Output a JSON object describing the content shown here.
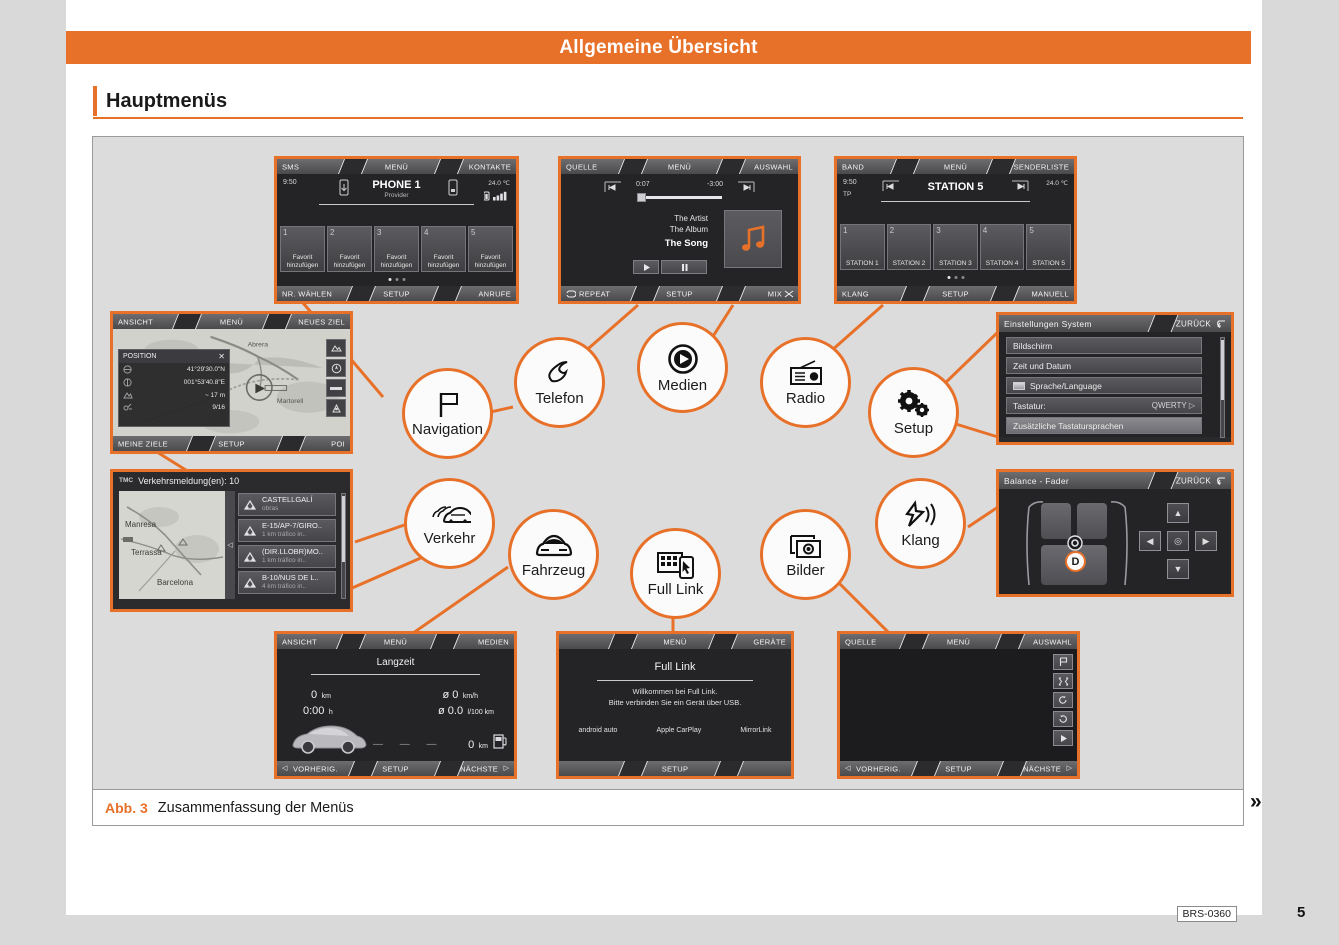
{
  "header": {
    "title": "Allgemeine Übersicht"
  },
  "section": {
    "title": "Hauptmenüs"
  },
  "figure": {
    "abb": "Abb. 3",
    "caption": "Zusammenfassung der Menüs",
    "code": "BRS-0360",
    "next_chevron": "»"
  },
  "page_number": "5",
  "nodes": [
    {
      "id": "navigation",
      "label": "Navigation",
      "icon": "flag-icon"
    },
    {
      "id": "telefon",
      "label": "Telefon",
      "icon": "phone-icon"
    },
    {
      "id": "medien",
      "label": "Medien",
      "icon": "play-circle-icon"
    },
    {
      "id": "radio",
      "label": "Radio",
      "icon": "radio-icon"
    },
    {
      "id": "setup",
      "label": "Setup",
      "icon": "gears-icon"
    },
    {
      "id": "verkehr",
      "label": "Verkehr",
      "icon": "traffic-cars-icon"
    },
    {
      "id": "fahrzeug",
      "label": "Fahrzeug",
      "icon": "car-icon"
    },
    {
      "id": "fulllink",
      "label": "Full Link",
      "icon": "fulllink-icon"
    },
    {
      "id": "bilder",
      "label": "Bilder",
      "icon": "photos-icon"
    },
    {
      "id": "klang",
      "label": "Klang",
      "icon": "speaker-icon"
    }
  ],
  "screens": {
    "phone": {
      "top": {
        "left": "SMS",
        "center": "MENÜ",
        "right": "KONTAKTE"
      },
      "bottom": {
        "left": "NR. WÄHLEN",
        "center": "SETUP",
        "right": "ANRUFE"
      },
      "clock": "9:50",
      "temp": "24.0 ℃",
      "title": "PHONE 1",
      "subtitle": "Provider",
      "presets": [
        {
          "num": "1",
          "label": "Favorit hinzufügen"
        },
        {
          "num": "2",
          "label": "Favorit hinzufügen"
        },
        {
          "num": "3",
          "label": "Favorit hinzufügen"
        },
        {
          "num": "4",
          "label": "Favorit hinzufügen"
        },
        {
          "num": "5",
          "label": "Favorit hinzufügen"
        }
      ]
    },
    "media": {
      "top": {
        "left": "QUELLE",
        "center": "MENÜ",
        "right": "AUSWAHL"
      },
      "bottom": {
        "left": "REPEAT",
        "center": "SETUP",
        "right": "MIX"
      },
      "elapsed": "0:07",
      "remaining": "-3:00",
      "artist": "The Artist",
      "album": "The Album",
      "song": "The Song"
    },
    "radio": {
      "top": {
        "left": "BAND",
        "center": "MENÜ",
        "right": "SENDERLISTE"
      },
      "bottom": {
        "left": "KLANG",
        "center": "SETUP",
        "right": "MANUELL"
      },
      "clock": "9:50",
      "tp": "TP",
      "temp": "24.0 ℃",
      "title": "STATION 5",
      "presets": [
        {
          "num": "1",
          "label": "STATION 1"
        },
        {
          "num": "2",
          "label": "STATION 2"
        },
        {
          "num": "3",
          "label": "STATION 3"
        },
        {
          "num": "4",
          "label": "STATION 4"
        },
        {
          "num": "5",
          "label": "STATION 5"
        }
      ]
    },
    "navigation": {
      "top": {
        "left": "ANSICHT",
        "center": "MENÜ",
        "right": "NEUES ZIEL"
      },
      "bottom": {
        "left": "MEINE ZIELE",
        "center": "SETUP",
        "right": "POI"
      },
      "panel_title": "POSITION",
      "close": "✕",
      "rows": [
        {
          "value": "41°29'30.0\"N"
        },
        {
          "value": "001°53'40.8\"E"
        },
        {
          "value": "~ 17 m"
        },
        {
          "value": "9/16"
        }
      ],
      "map_labels": [
        "Abrera",
        "Martorell"
      ]
    },
    "settings": {
      "title": "Einstellungen System",
      "back": "ZURÜCK",
      "rows": [
        {
          "label": "Bildschirm",
          "value": ""
        },
        {
          "label": "Zeit und Datum",
          "value": ""
        },
        {
          "label": "Sprache/Language",
          "value": ""
        },
        {
          "label": "Tastatur:",
          "value": "QWERTY ▷"
        },
        {
          "label": "Zusätzliche Tastatursprachen",
          "value": ""
        }
      ]
    },
    "traffic": {
      "tmc": "TMC",
      "title": "Verkehrsmeldung(en): 10",
      "map_labels": [
        "Manresa",
        "Terrassa",
        "Barcelona"
      ],
      "items": [
        {
          "name": "CASTELLGALÍ",
          "desc": "obras"
        },
        {
          "name": "E-15/AP-7/GIRO..",
          "desc": "1 km tráfico in.."
        },
        {
          "name": "(DIR.LLOBR)MO..",
          "desc": "1 km tráfico in.."
        },
        {
          "name": "B-10/NUS DE L..",
          "desc": "4 km tráfico in.."
        }
      ]
    },
    "balance": {
      "title": "Balance - Fader",
      "back": "ZURÜCK",
      "marker": "D"
    },
    "vehicle": {
      "top": {
        "left": "ANSICHT",
        "center": "MENÜ",
        "right": "MEDIEN"
      },
      "bottom": {
        "left": "VORHERIG.",
        "center": "SETUP",
        "right": "NÄCHSTE"
      },
      "title": "Langzeit",
      "dist": "0",
      "dist_unit": "km",
      "time": "0:00",
      "time_unit": "h",
      "avg_speed": "ø 0",
      "avg_speed_unit": "km/h",
      "avg_cons": "ø 0.0",
      "avg_cons_unit": "l/100 km",
      "range": "0",
      "range_unit": "km"
    },
    "fulllink": {
      "top": {
        "left": "",
        "center": "MENÜ",
        "right": "GERÄTE"
      },
      "bottom": {
        "left": "",
        "center": "SETUP",
        "right": ""
      },
      "title": "Full Link",
      "line1": "Willkommen bei Full Link.",
      "line2": "Bitte verbinden Sie ein Gerät über USB.",
      "logos": [
        "android auto",
        "Apple CarPlay",
        "MirrorLink"
      ]
    },
    "pictures": {
      "top": {
        "left": "QUELLE",
        "center": "MENÜ",
        "right": "AUSWAHL"
      },
      "bottom": {
        "left": "VORHERIG.",
        "center": "SETUP",
        "right": "NÄCHSTE"
      },
      "tools": [
        "flag-icon",
        "fullscreen-icon",
        "rotate-ccw-icon",
        "rotate-cw-icon",
        "play-icon"
      ]
    }
  },
  "colors": {
    "accent": "#e8712a",
    "page_bg": "#d9d9d9",
    "figure_bg": "#dcdcdc",
    "screen_bg": "#242426"
  }
}
